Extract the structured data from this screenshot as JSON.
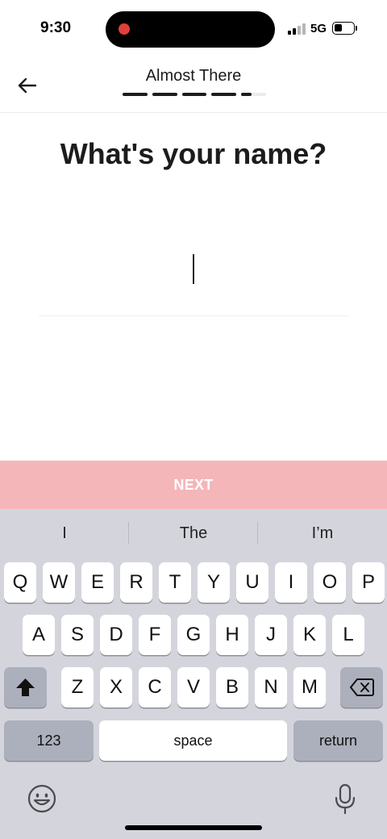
{
  "status": {
    "time": "9:30",
    "network": "5G"
  },
  "header": {
    "title": "Almost There",
    "progress": {
      "completed_steps": 4.4,
      "total_steps": 5
    }
  },
  "form": {
    "question": "What's your name?",
    "name_value": ""
  },
  "next_label": "NEXT",
  "keyboard": {
    "suggestions": [
      "I",
      "The",
      "I’m"
    ],
    "rows": [
      [
        "Q",
        "W",
        "E",
        "R",
        "T",
        "Y",
        "U",
        "I",
        "O",
        "P"
      ],
      [
        "A",
        "S",
        "D",
        "F",
        "G",
        "H",
        "J",
        "K",
        "L"
      ],
      [
        "Z",
        "X",
        "C",
        "V",
        "B",
        "N",
        "M"
      ]
    ],
    "numbers_label": "123",
    "space_label": "space",
    "return_label": "return"
  },
  "colors": {
    "accent": "#f4b6b8",
    "progress_done": "#1c1c1c",
    "progress_remaining": "#ececec",
    "keyboard_bg": "#d4d5dc"
  },
  "icons": {
    "back": "arrow-left-icon",
    "shift": "shift-icon",
    "delete": "backspace-icon",
    "emoji": "emoji-icon",
    "mic": "microphone-icon",
    "record": "recording-dot-icon"
  }
}
